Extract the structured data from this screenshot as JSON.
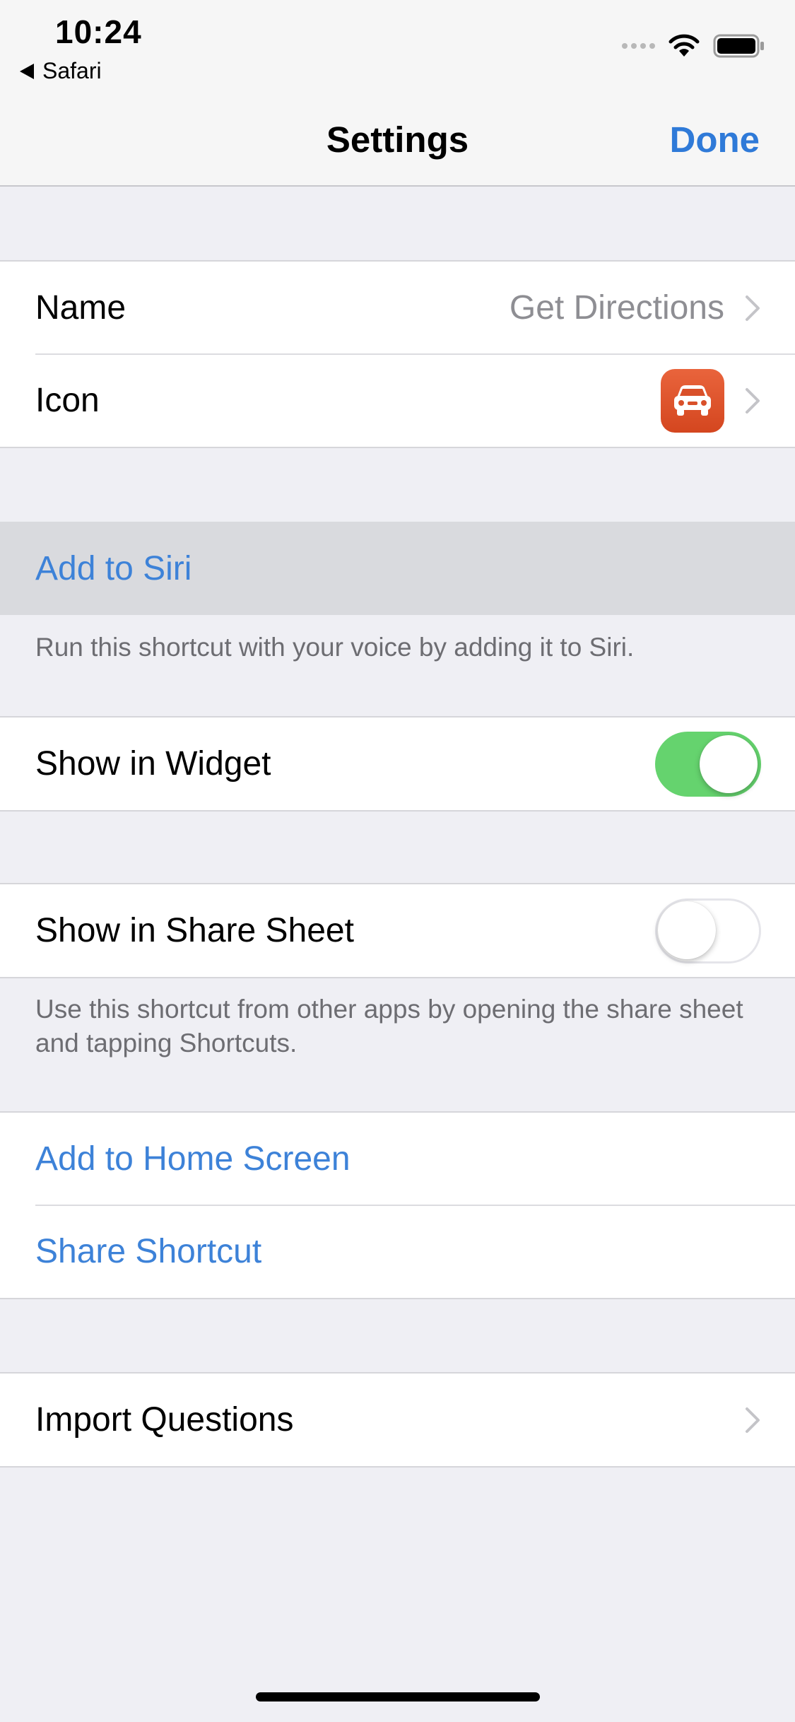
{
  "status_bar": {
    "time": "10:24",
    "back_app": "Safari",
    "icons": [
      "cellular-signal-icon",
      "wifi-icon",
      "battery-icon"
    ]
  },
  "nav": {
    "title": "Settings",
    "done_label": "Done",
    "accent_color": "#2f7ad8"
  },
  "details": {
    "name_label": "Name",
    "name_value": "Get Directions",
    "icon_label": "Icon",
    "icon_glyph": "car-icon",
    "icon_color": "#e0552b"
  },
  "siri": {
    "add_label": "Add to Siri",
    "footer": "Run this shortcut with your voice by adding it to Siri."
  },
  "widget": {
    "label": "Show in Widget",
    "enabled": true
  },
  "share_sheet": {
    "label": "Show in Share Sheet",
    "enabled": false,
    "footer": "Use this shortcut from other apps by opening the share sheet and tapping Shortcuts."
  },
  "actions": {
    "home_screen_label": "Add to Home Screen",
    "share_label": "Share Shortcut"
  },
  "import": {
    "label": "Import Questions"
  }
}
